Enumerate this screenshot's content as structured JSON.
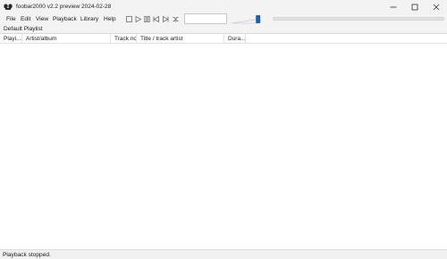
{
  "window": {
    "title": "foobar2000 v2.2 preview 2024-02-28"
  },
  "menu": [
    "File",
    "Edit",
    "View",
    "Playback",
    "Library",
    "Help"
  ],
  "toolbar": {
    "buttons": [
      "stop-icon",
      "play-icon",
      "pause-icon",
      "previous-icon",
      "next-icon",
      "random-icon"
    ],
    "search_value": "",
    "volume_level": 0.9,
    "seek_position": 0
  },
  "playlist": {
    "tab_label": "Default Playlist",
    "columns": [
      "Playi...",
      "Artist/album",
      "Track no",
      "Title / track artist",
      "Dura..."
    ],
    "rows": []
  },
  "status": {
    "text": "Playback stopped."
  },
  "colors": {
    "chrome": "#f3f3f3",
    "accent": "#1e5fb4"
  }
}
